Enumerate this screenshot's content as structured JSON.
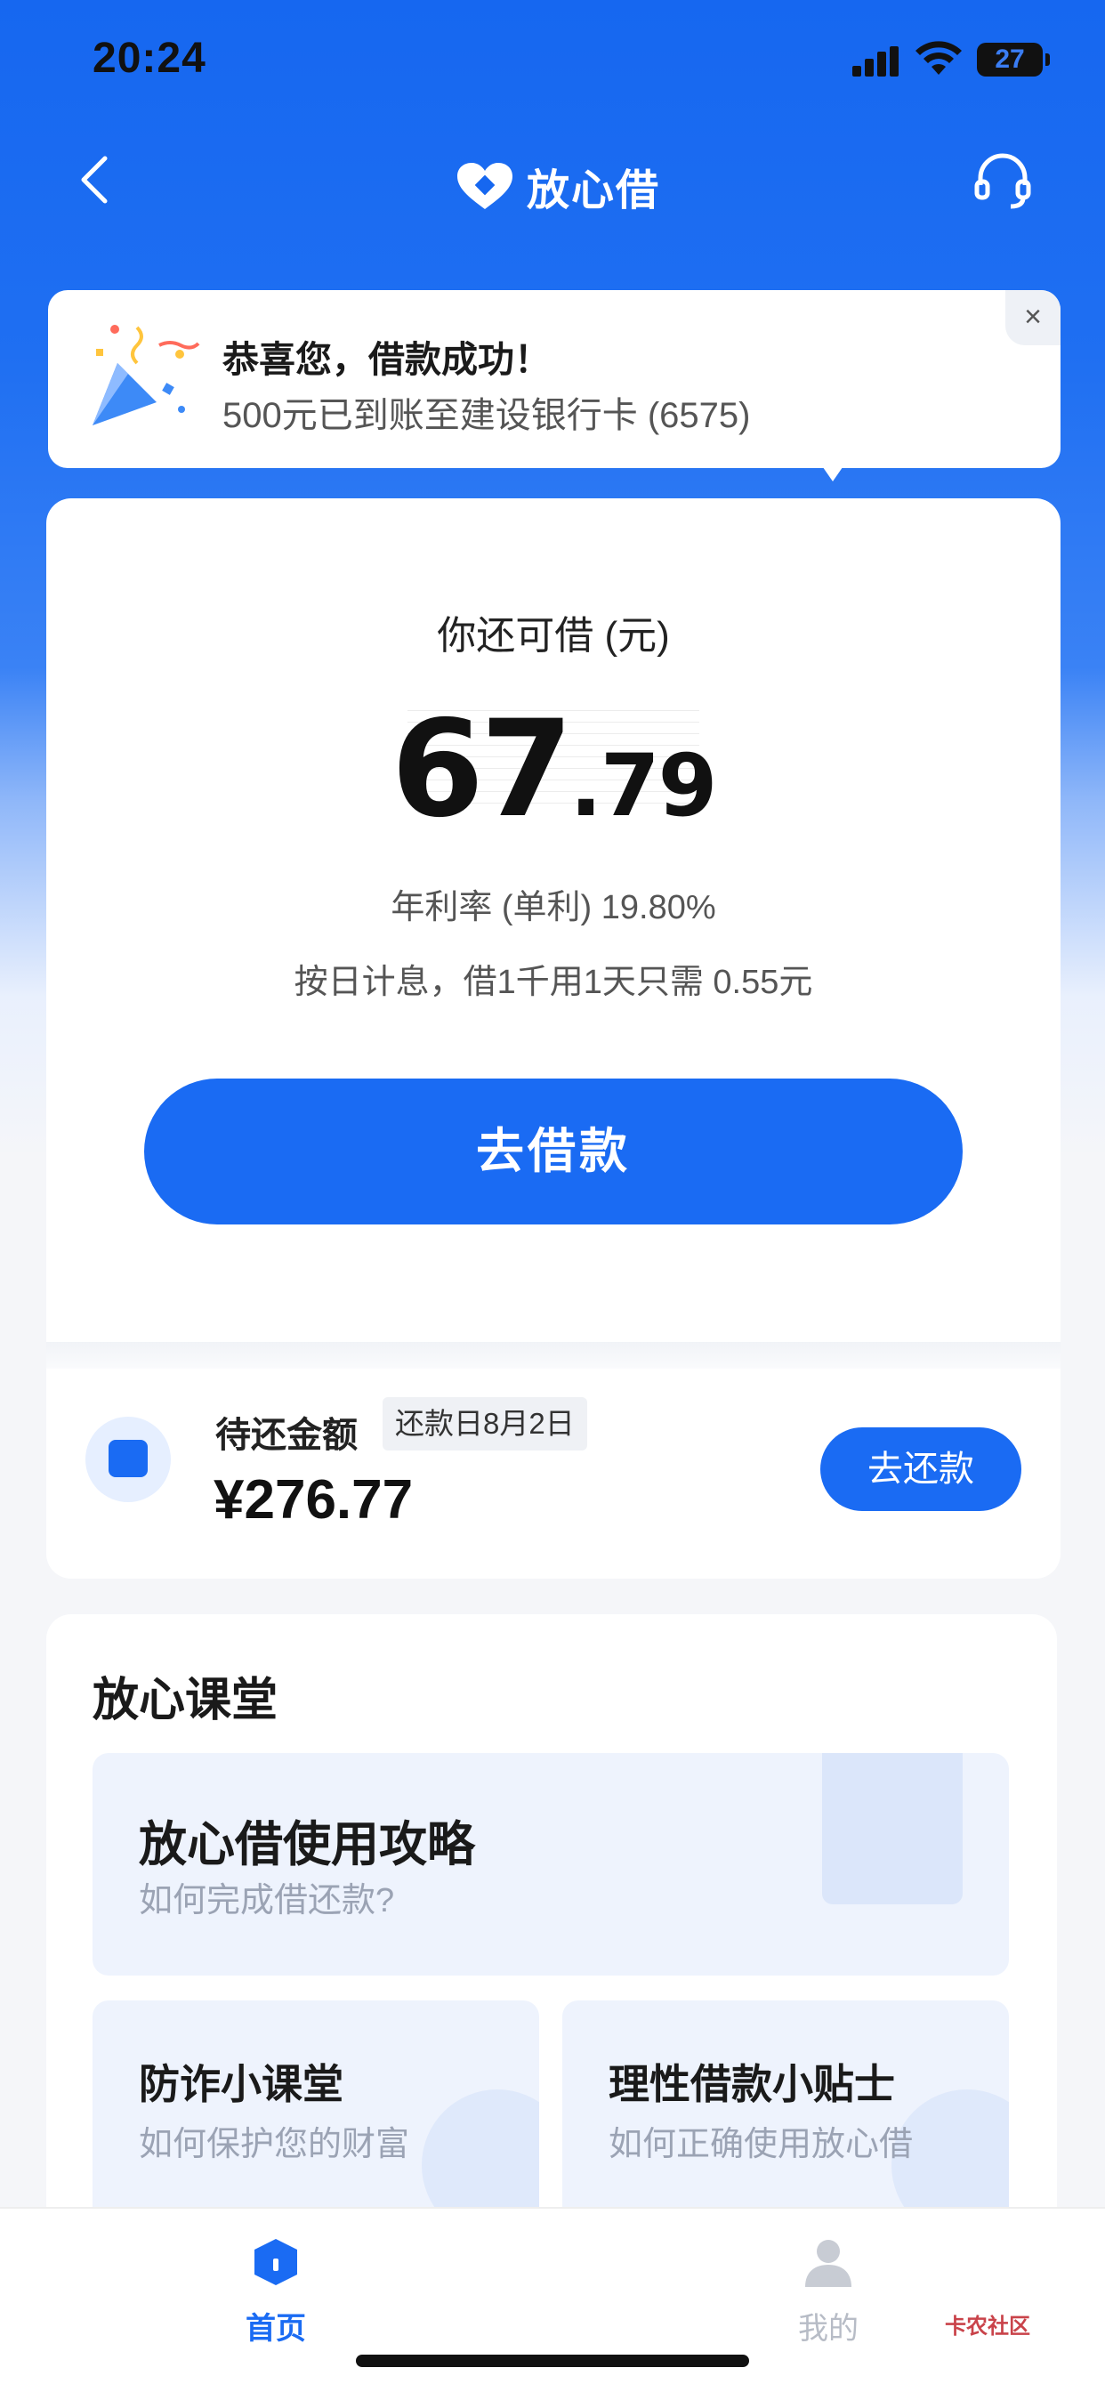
{
  "status_bar": {
    "time": "20:24",
    "battery": "27"
  },
  "nav": {
    "brand": "放心借"
  },
  "toast": {
    "title": "恭喜您，借款成功！",
    "subtitle": "500元已到账至建设银行卡 (6575)",
    "close": "×"
  },
  "loan": {
    "available_label": "你还可借 (元)",
    "amount_int": "67",
    "amount_dec": ".79",
    "rate": "年利率 (单利) 19.80%",
    "daily": "按日计息，借1千用1天只需 0.55元",
    "borrow_button": "去借款"
  },
  "repay": {
    "label": "待还金额",
    "due_date": "还款日8月2日",
    "amount": "¥276.77",
    "button": "去还款"
  },
  "classroom": {
    "title": "放心课堂",
    "guide": {
      "title": "放心借使用攻略",
      "subtitle": "如何完成借还款?"
    },
    "fraud": {
      "title": "防诈小课堂",
      "subtitle": "如何保护您的财富"
    },
    "tips": {
      "title": "理性借款小贴士",
      "subtitle": "如何正确使用放心借"
    }
  },
  "tabbar": {
    "home": "首页",
    "mine": "我的"
  },
  "watermark": "卡农社区",
  "colors": {
    "accent": "#1a6bf3",
    "header": "#1667f0"
  }
}
